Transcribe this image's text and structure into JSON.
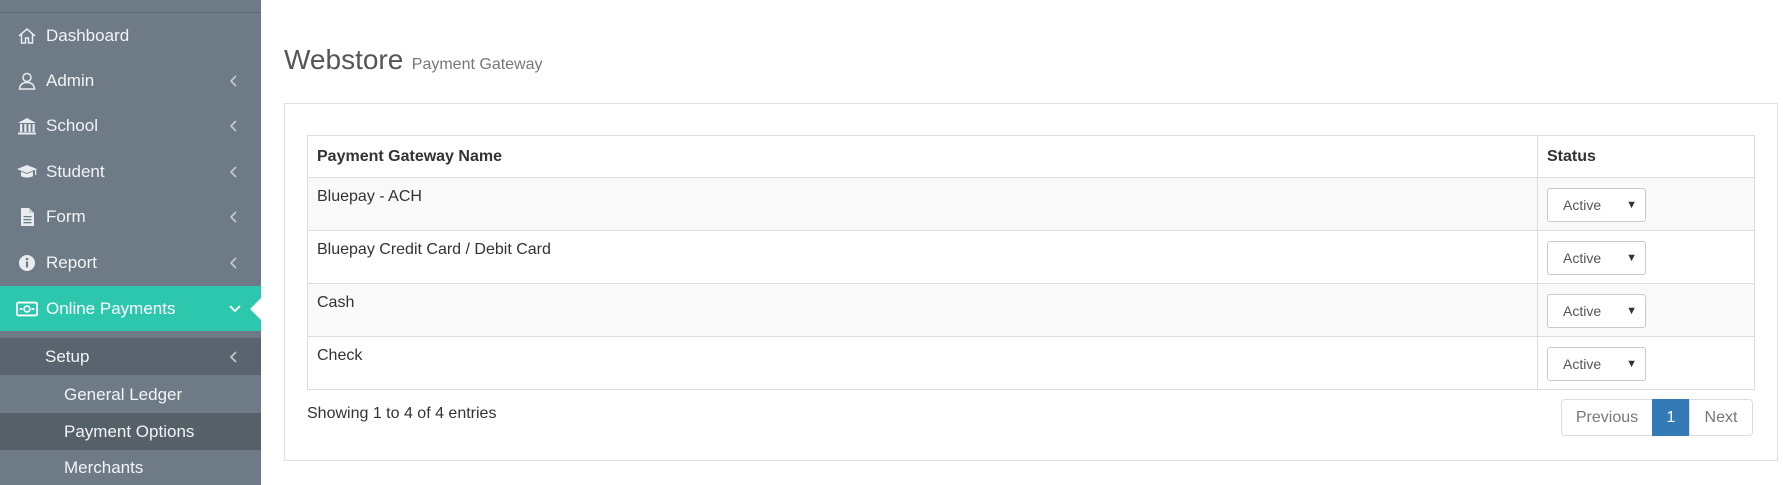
{
  "sidebar": {
    "items": [
      {
        "label": "Dashboard",
        "icon": "home-icon"
      },
      {
        "label": "Admin",
        "icon": "user-icon"
      },
      {
        "label": "School",
        "icon": "bank-icon"
      },
      {
        "label": "Student",
        "icon": "graduation-cap-icon"
      },
      {
        "label": "Form",
        "icon": "file-icon"
      },
      {
        "label": "Report",
        "icon": "info-icon"
      },
      {
        "label": "Online Payments",
        "icon": "money-icon"
      }
    ],
    "setup_label": "Setup",
    "sub_items": [
      "General Ledger",
      "Payment Options",
      "Merchants"
    ]
  },
  "page": {
    "title": "Webstore",
    "subtitle": "Payment Gateway"
  },
  "table": {
    "headers": [
      "Payment Gateway Name",
      "Status"
    ],
    "rows": [
      {
        "name": "Bluepay - ACH",
        "status": "Active"
      },
      {
        "name": "Bluepay Credit Card / Debit Card",
        "status": "Active"
      },
      {
        "name": "Cash",
        "status": "Active"
      },
      {
        "name": "Check",
        "status": "Active"
      }
    ],
    "info": "Showing 1 to 4 of 4 entries"
  },
  "pagination": {
    "previous": "Previous",
    "current": "1",
    "next": "Next"
  },
  "colors": {
    "sidebar_bg": "#6e7a86",
    "active_accent": "#2cc7ad",
    "pager_active": "#337ab7"
  }
}
